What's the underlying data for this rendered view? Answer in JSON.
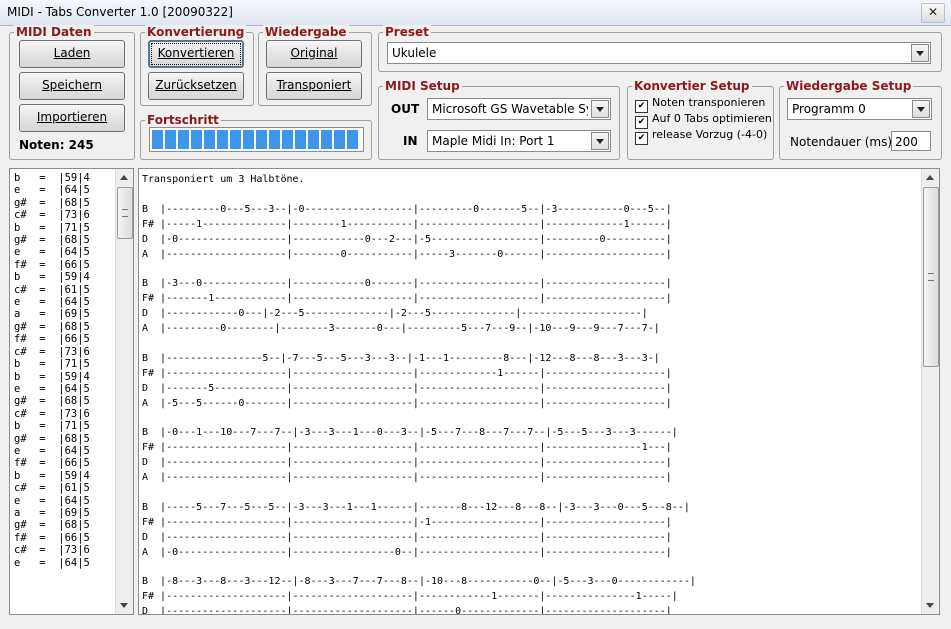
{
  "window": {
    "title": "MIDI - Tabs Converter 1.0  [20090322]",
    "close": "✕"
  },
  "midi_daten": {
    "title": "MIDI Daten",
    "load": "Laden",
    "save": "Speichern",
    "import": "Importieren",
    "notes_label": "Noten: 245"
  },
  "konvertierung": {
    "title": "Konvertierung",
    "convert": "Konvertieren",
    "reset": "Zurücksetzen"
  },
  "wiedergabe": {
    "title": "Wiedergabe",
    "original": "Original",
    "transposed": "Transponiert"
  },
  "preset": {
    "title": "Preset",
    "value": "Ukulele"
  },
  "fortschritt": {
    "title": "Fortschritt",
    "progress": 1.0
  },
  "midi_setup": {
    "title": "MIDI Setup",
    "out_label": "OUT",
    "out_value": "Microsoft GS Wavetable Synth",
    "in_label": "IN",
    "in_value": "Maple Midi In: Port 1"
  },
  "konvertier_setup": {
    "title": "Konvertier Setup",
    "opt1": "Noten transponieren",
    "opt2": "Auf 0 Tabs optimieren",
    "opt3": "release Vorzug (-4-0)",
    "check": "✔"
  },
  "wiedergabe_setup": {
    "title": "Wiedergabe Setup",
    "program": "Programm 0",
    "duration_label": "Notendauer (ms)",
    "duration_value": "200"
  },
  "note_list": "b   =  |59|4\ne   =  |64|5\ng#  =  |68|5\nc#  =  |73|6\nb   =  |71|5\ng#  =  |68|5\ne   =  |64|5\nf#  =  |66|5\nb   =  |59|4\nc#  =  |61|5\ne   =  |64|5\na   =  |69|5\ng#  =  |68|5\nf#  =  |66|5\nc#  =  |73|6\nb   =  |71|5\nb   =  |59|4\ne   =  |64|5\ng#  =  |68|5\nc#  =  |73|6\nb   =  |71|5\ng#  =  |68|5\ne   =  |64|5\nf#  =  |66|5\nb   =  |59|4\nc#  =  |61|5\ne   =  |64|5\na   =  |69|5\ng#  =  |68|5\nf#  =  |66|5\nc#  =  |73|6\ne   =  |64|5",
  "tab_text": "Transponiert um 3 Halbtöne.\n\nB  |---------0---5---3--|-0------------------|---------0-------5--|-3-----------0---5--|\nF# |-----1--------------|--------1-----------|--------------------|-------------1------|\nD  |-0------------------|------------0---2---|-5------------------|---------0----------|\nA  |--------------------|--------0-----------|-----3-------0------|--------------------|\n\nB  |-3---0--------------|------------0-------|--------------------|--------------------|\nF# |-------1------------|--------------------|--------------------|--------------------|\nD  |------------0---|-2---5--------------|-2---5--------------|--------------------|\nA  |---------0--------|--------3-------0---|---------5---7---9--|-10---9---9---7---7-|\n\nB  |----------------5--|-7---5---5---3---3--|-1---1---------8---|-12---8---8---3---3-|\nF# |--------------------|--------------------|-------------1------|--------------------|\nD  |-------5------------|--------------------|--------------------|--------------------|\nA  |-5---5------0-------|--------------------|--------------------|--------------------|\n\nB  |-0---1---10---7---7--|-3---3---1---0---3--|-5---7---8---7---7--|-5---5---3---3------|\nF# |--------------------|--------------------|--------------------|----------------1---|\nD  |--------------------|--------------------|--------------------|--------------------|\nA  |--------------------|--------------------|--------------------|--------------------|\n\nB  |-----5---7---5---5--|-3---3---1---1------|-------8---12---8---8--|-3---3---0---5---8--|\nF# |--------------------|--------------------|-1------------------|--------------------|\nD  |--------------------|--------------------|--------------------|--------------------|\nA  |-0------------------|-----------------0--|--------------------|--------------------|\n\nB  |-8---3---8---3---12--|-8---3---7---7---8--|-10---8-----------0--|-5---3---0------------|\nF# |--------------------|--------------------|------------1-------|---------------1-----|\nD  |--------------------|--------------------|------0-------------|--------------------|"
}
